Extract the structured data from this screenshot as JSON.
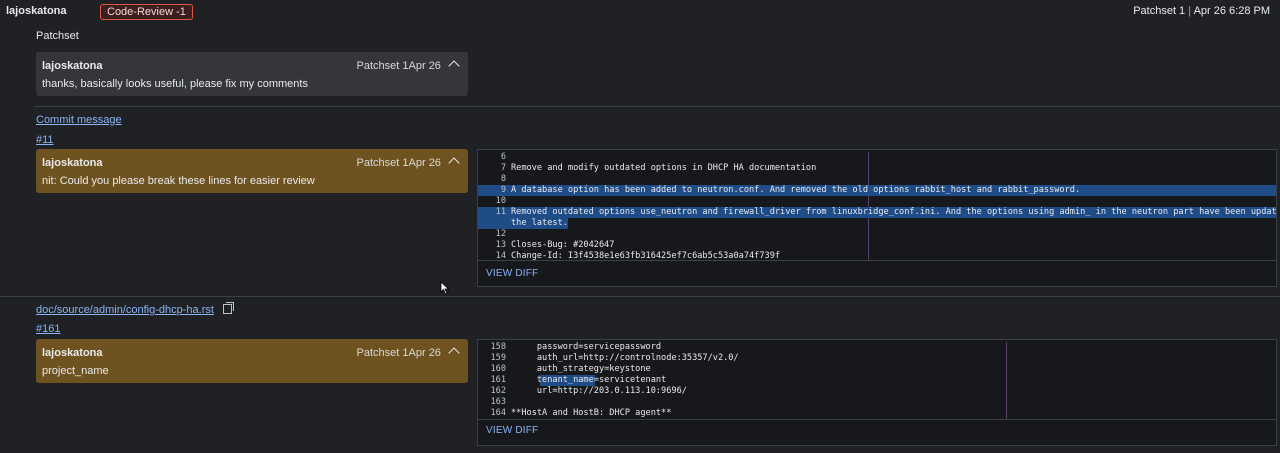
{
  "header": {
    "author": "lajoskatona",
    "vote_badge": "Code-Review -1",
    "patchset": "Patchset 1",
    "date": "Apr 26 6:28 PM"
  },
  "patchset_section": {
    "label": "Patchset",
    "comment": {
      "author": "lajoskatona",
      "patchset": "Patchset 1",
      "date": "Apr 26",
      "text": "thanks, basically looks useful, please fix my comments"
    }
  },
  "commit_section": {
    "link": "Commit message",
    "line_link": "#11",
    "comment": {
      "author": "lajoskatona",
      "patchset": "Patchset 1",
      "date": "Apr 26",
      "text": "nit: Could you please break these lines for easier review"
    },
    "code": [
      {
        "n": "6",
        "t": ""
      },
      {
        "n": "7",
        "t": "Remove and modify outdated options in DHCP HA documentation"
      },
      {
        "n": "8",
        "t": ""
      },
      {
        "n": "9",
        "t": "A database option has been added to neutron.conf. And removed the old options rabbit_host and rabbit_password."
      },
      {
        "n": "10",
        "t": ""
      },
      {
        "n": "11",
        "t": "Removed outdated options use_neutron and firewall_driver from linuxbridge_conf.ini. And the options using admin_ in the neutron part have been updated to"
      },
      {
        "n": "",
        "t": "the latest."
      },
      {
        "n": "12",
        "t": ""
      },
      {
        "n": "13",
        "t": "Closes-Bug: #2042647"
      },
      {
        "n": "14",
        "t": "Change-Id: I3f4538e1e63fb316425ef7c6ab5c53a0a74f739f"
      }
    ],
    "view_diff": "VIEW DIFF"
  },
  "file_section": {
    "link": "doc/source/admin/config-dhcp-ha.rst",
    "line_link": "#161",
    "comment": {
      "author": "lajoskatona",
      "patchset": "Patchset 1",
      "date": "Apr 26",
      "text": "project_name"
    },
    "code": [
      {
        "n": "158",
        "t": "     password=servicepassword"
      },
      {
        "n": "159",
        "t": "     auth_url=http://controlnode:35357/v2.0/"
      },
      {
        "n": "160",
        "t": "     auth_strategy=keystone"
      },
      {
        "n": "161",
        "t": "     tenant_name=servicetenant"
      },
      {
        "n": "162",
        "t": "     url=http://203.0.113.10:9696/"
      },
      {
        "n": "163",
        "t": ""
      },
      {
        "n": "164",
        "t": "**HostA and HostB: DHCP agent**"
      }
    ],
    "view_diff": "VIEW DIFF"
  },
  "icons": [
    "chevron-up-icon",
    "copy-icon",
    "mouse-cursor-icon"
  ],
  "colors": {
    "background": "#202124",
    "vote_border": "#e5534b",
    "comment_gray": "#35363a",
    "comment_draft_yellow": "#6e5320",
    "link": "#8ab4f8",
    "code_highlight": "#1f4b87"
  }
}
